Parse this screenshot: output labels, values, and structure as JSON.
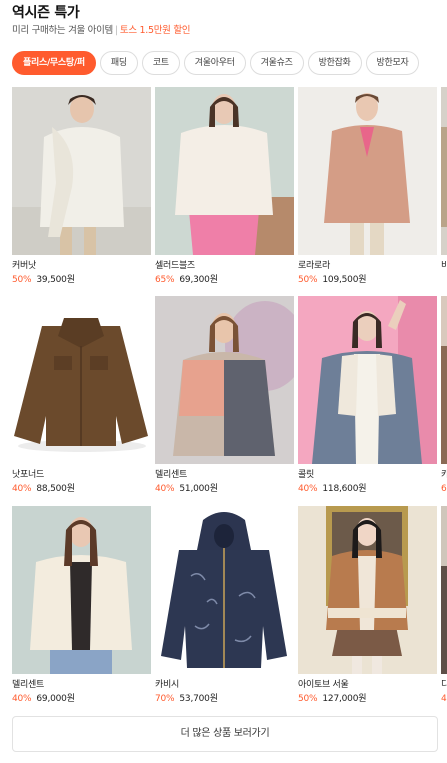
{
  "header": {
    "title": "역시즌 특가",
    "subtitle": "미리 구매하는 겨울 아이템",
    "separator": "|",
    "promo": "토스 1.5만원 할인"
  },
  "chips": [
    {
      "label": "플리스/무스탕/퍼",
      "active": true
    },
    {
      "label": "패딩",
      "active": false
    },
    {
      "label": "코트",
      "active": false
    },
    {
      "label": "겨울아우터",
      "active": false
    },
    {
      "label": "겨울슈즈",
      "active": false
    },
    {
      "label": "방한잡화",
      "active": false
    },
    {
      "label": "방한모자",
      "active": false
    }
  ],
  "products": [
    {
      "brand": "커버낫",
      "discount": "50%",
      "price": "39,500원",
      "image": "white-fleece-jacket"
    },
    {
      "brand": "셀러드블즈",
      "discount": "65%",
      "price": "69,300원",
      "image": "cream-fur-jacket"
    },
    {
      "brand": "로라로라",
      "discount": "50%",
      "price": "109,500원",
      "image": "pink-shearling-coat"
    },
    {
      "brand": "비",
      "discount": "",
      "price": "",
      "image": "partial-item"
    },
    {
      "brand": "낫포너드",
      "discount": "40%",
      "price": "88,500원",
      "image": "brown-fur-jacket"
    },
    {
      "brand": "델리센트",
      "discount": "40%",
      "price": "51,000원",
      "image": "colorblock-fleece"
    },
    {
      "brand": "콜릿",
      "discount": "40%",
      "price": "118,600원",
      "image": "grey-mustang-jacket"
    },
    {
      "brand": "카",
      "discount": "6",
      "price": "",
      "image": "partial-item"
    },
    {
      "brand": "델리센트",
      "discount": "40%",
      "price": "69,000원",
      "image": "ivory-fur-jacket"
    },
    {
      "brand": "카비시",
      "discount": "70%",
      "price": "53,700원",
      "image": "navy-print-hoodie"
    },
    {
      "brand": "아이토브 서울",
      "discount": "50%",
      "price": "127,000원",
      "image": "tan-mustang-jacket"
    },
    {
      "brand": "디",
      "discount": "4",
      "price": "",
      "image": "partial-item"
    }
  ],
  "more_button": "더 많은 상품 보러가기",
  "colors": {
    "accent": "#ff5b2e"
  }
}
